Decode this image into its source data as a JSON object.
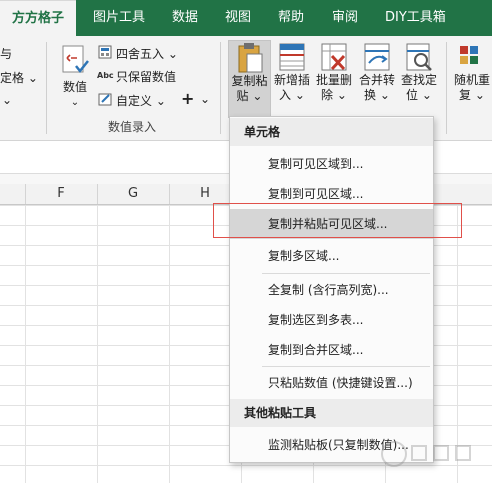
{
  "tabs": [
    {
      "label": "方方格子",
      "active": true
    },
    {
      "label": "图片工具",
      "active": false
    },
    {
      "label": "数据",
      "active": false
    },
    {
      "label": "视图",
      "active": false
    },
    {
      "label": "帮助",
      "active": false
    },
    {
      "label": "审阅",
      "active": false
    },
    {
      "label": "DIY工具箱",
      "active": false
    }
  ],
  "ribbon": {
    "left_partial": {
      "row1": "与",
      "row2": "定格",
      "row3": ""
    },
    "numeric_button": {
      "label": "数值"
    },
    "round_label": "四舍五入",
    "keep_value_label": "只保留数值",
    "custom_label": "自定义",
    "plus_label": "+",
    "numeric_group_label": "数值录入",
    "copy_paste": {
      "line1": "复制粘",
      "line2": "贴"
    },
    "insert_blank": {
      "line1": "新增插",
      "line2": "入"
    },
    "batch_delete": {
      "line1": "批量删",
      "line2": "除"
    },
    "merge_convert": {
      "line1": "合并转",
      "line2": "换"
    },
    "find_locate": {
      "line1": "查找定",
      "line2": "位"
    },
    "random_repeat": {
      "line1": "随机重",
      "line2": "复"
    }
  },
  "columns": [
    "F",
    "G",
    "H"
  ],
  "menu": {
    "header1": "单元格",
    "items1": [
      "复制可见区域到...",
      "复制到可见区域...",
      "复制并粘贴可见区域...",
      "复制多区域...",
      "全复制 (含行高列宽)...",
      "复制选区到多表...",
      "复制到合并区域...",
      "只粘贴数值 (快捷键设置...)"
    ],
    "highlighted_index": 2,
    "header2": "其他粘贴工具",
    "items2": [
      "监测粘贴板(只复制数值)..."
    ]
  },
  "colors": {
    "accent": "#217346",
    "highlight": "#d6d6d6",
    "callout": "#e0504a"
  }
}
